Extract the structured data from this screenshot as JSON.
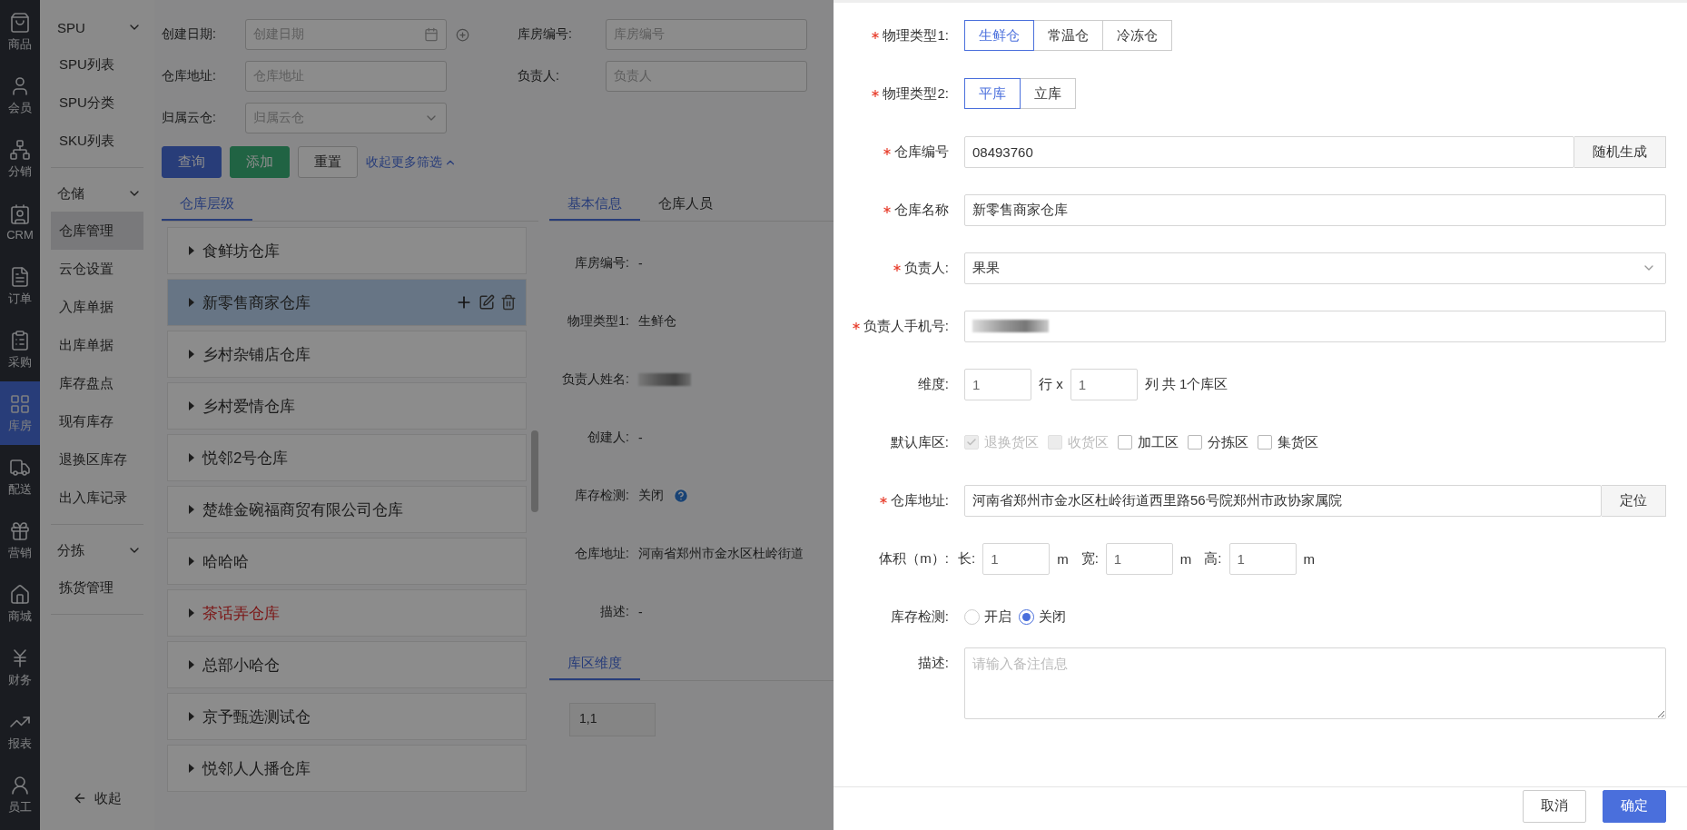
{
  "nav_rail": {
    "items": [
      {
        "label": "商品",
        "selected": false
      },
      {
        "label": "会员",
        "selected": false
      },
      {
        "label": "分销",
        "selected": false
      },
      {
        "label": "CRM",
        "selected": false
      },
      {
        "label": "订单",
        "selected": false
      },
      {
        "label": "采购",
        "selected": false
      },
      {
        "label": "库房",
        "selected": true
      },
      {
        "label": "配送",
        "selected": false
      },
      {
        "label": "营销",
        "selected": false
      },
      {
        "label": "商城",
        "selected": false
      },
      {
        "label": "财务",
        "selected": false
      },
      {
        "label": "报表",
        "selected": false
      },
      {
        "label": "员工",
        "selected": false
      }
    ]
  },
  "submenu": {
    "groups": [
      {
        "title": "SPU",
        "expanded": true,
        "items": [
          {
            "label": "SPU列表",
            "selected": false
          },
          {
            "label": "SPU分类",
            "selected": false
          },
          {
            "label": "SKU列表",
            "selected": false
          }
        ]
      },
      {
        "title": "仓储",
        "expanded": true,
        "items": [
          {
            "label": "仓库管理",
            "selected": true
          },
          {
            "label": "云仓设置",
            "selected": false
          },
          {
            "label": "入库单据",
            "selected": false
          },
          {
            "label": "出库单据",
            "selected": false
          },
          {
            "label": "库存盘点",
            "selected": false
          },
          {
            "label": "现有库存",
            "selected": false
          },
          {
            "label": "退换区库存",
            "selected": false
          },
          {
            "label": "出入库记录",
            "selected": false
          }
        ]
      },
      {
        "title": "分拣",
        "expanded": true,
        "items": [
          {
            "label": "拣货管理",
            "selected": false
          }
        ]
      }
    ],
    "collapse": "收起"
  },
  "filters": {
    "fields": [
      {
        "label": "创建日期:",
        "placeholder": "创建日期",
        "kind": "date"
      },
      {
        "label": "库房编号:",
        "placeholder": "库房编号",
        "kind": "text"
      },
      {
        "label": "仓库地址:",
        "placeholder": "仓库地址",
        "kind": "text"
      },
      {
        "label": "负责人:",
        "placeholder": "负责人",
        "kind": "text"
      },
      {
        "label": "归属云仓:",
        "placeholder": "归属云仓",
        "kind": "select"
      }
    ],
    "buttons": [
      {
        "label": "查询",
        "kind": "primary"
      },
      {
        "label": "添加",
        "kind": "success"
      },
      {
        "label": "重置",
        "kind": "default"
      }
    ],
    "toggle": "收起更多筛选"
  },
  "tree": {
    "tab": {
      "label": "仓库层级",
      "selected": true
    },
    "items": [
      {
        "label": "食鲜坊仓库",
        "selected": false,
        "alert": false
      },
      {
        "label": "新零售商家仓库",
        "selected": true,
        "alert": false
      },
      {
        "label": "乡村杂铺店仓库",
        "selected": false,
        "alert": false
      },
      {
        "label": "乡村爱情仓库",
        "selected": false,
        "alert": false
      },
      {
        "label": "悦邻2号仓库",
        "selected": false,
        "alert": false
      },
      {
        "label": "楚雄金碗福商贸有限公司仓库",
        "selected": false,
        "alert": false
      },
      {
        "label": "哈哈哈",
        "selected": false,
        "alert": false
      },
      {
        "label": "茶话弄仓库",
        "selected": false,
        "alert": true
      },
      {
        "label": "总部小哈仓",
        "selected": false,
        "alert": false
      },
      {
        "label": "京予甄选测试仓",
        "selected": false,
        "alert": false
      },
      {
        "label": "悦邻人人播仓库",
        "selected": false,
        "alert": false
      }
    ]
  },
  "detail": {
    "tabs": [
      {
        "label": "基本信息",
        "selected": true
      },
      {
        "label": "仓库人员",
        "selected": false
      }
    ],
    "fields": [
      {
        "label": "库房编号:",
        "value": "-",
        "kind": "text"
      },
      {
        "label": "物理类型1:",
        "value": "生鲜仓",
        "kind": "text"
      },
      {
        "label": "负责人姓名:",
        "kind": "redacted"
      },
      {
        "label": "创建人:",
        "value": "-",
        "kind": "text"
      },
      {
        "label": "库存检测:",
        "value": "关闭",
        "kind": "help"
      },
      {
        "label": "仓库地址:",
        "value": "河南省郑州市金水区杜岭街道",
        "kind": "text"
      },
      {
        "label": "描述:",
        "value": "-",
        "kind": "text"
      }
    ],
    "zone_tab": {
      "label": "库区维度",
      "selected": true
    },
    "zones": [
      "1,1"
    ]
  },
  "drawer": {
    "rows": [
      {
        "kind": "segmented",
        "label": "物理类型1:",
        "required": true,
        "options": [
          {
            "label": "生鲜仓",
            "selected": true
          },
          {
            "label": "常温仓",
            "selected": false
          },
          {
            "label": "冷冻仓",
            "selected": false
          }
        ]
      },
      {
        "kind": "segmented",
        "label": "物理类型2:",
        "required": true,
        "options": [
          {
            "label": "平库",
            "selected": true
          },
          {
            "label": "立库",
            "selected": false
          }
        ]
      },
      {
        "kind": "input_button",
        "label": "仓库编号",
        "required": true,
        "value": "08493760",
        "button": "随机生成"
      },
      {
        "kind": "input",
        "label": "仓库名称",
        "required": true,
        "value": "新零售商家仓库"
      },
      {
        "kind": "select",
        "label": "负责人:",
        "required": true,
        "value": "果果"
      },
      {
        "kind": "redacted",
        "label": "负责人手机号:",
        "required": true
      },
      {
        "kind": "dimension",
        "label": "维度:",
        "required": false,
        "rows": "1",
        "rows_unit": "行 x",
        "cols": "1",
        "summary": "列 共 1个库区"
      },
      {
        "kind": "checkboxes",
        "label": "默认库区:",
        "required": false,
        "options": [
          {
            "label": "退换货区",
            "checked": true,
            "disabled": true
          },
          {
            "label": "收货区",
            "checked": false,
            "disabled": true
          },
          {
            "label": "加工区",
            "checked": false,
            "disabled": false
          },
          {
            "label": "分拣区",
            "checked": false,
            "disabled": false
          },
          {
            "label": "集货区",
            "checked": false,
            "disabled": false
          }
        ]
      },
      {
        "kind": "input_button",
        "label": "仓库地址:",
        "required": true,
        "value": "河南省郑州市金水区杜岭街道西里路56号院郑州市政协家属院",
        "button": "定位"
      },
      {
        "kind": "volume",
        "label": "体积（m）:",
        "required": false,
        "parts": [
          {
            "label": "长:",
            "value": "1",
            "unit": "m"
          },
          {
            "label": "宽:",
            "value": "1",
            "unit": "m"
          },
          {
            "label": "高:",
            "value": "1",
            "unit": "m"
          }
        ]
      },
      {
        "kind": "radio",
        "label": "库存检测:",
        "required": false,
        "options": [
          {
            "label": "开启",
            "selected": false
          },
          {
            "label": "关闭",
            "selected": true
          }
        ]
      },
      {
        "kind": "textarea",
        "label": "描述:",
        "required": false,
        "placeholder": "请输入备注信息"
      }
    ],
    "buttons": [
      {
        "label": "取消",
        "kind": "default"
      },
      {
        "label": "确定",
        "kind": "primary"
      }
    ]
  }
}
